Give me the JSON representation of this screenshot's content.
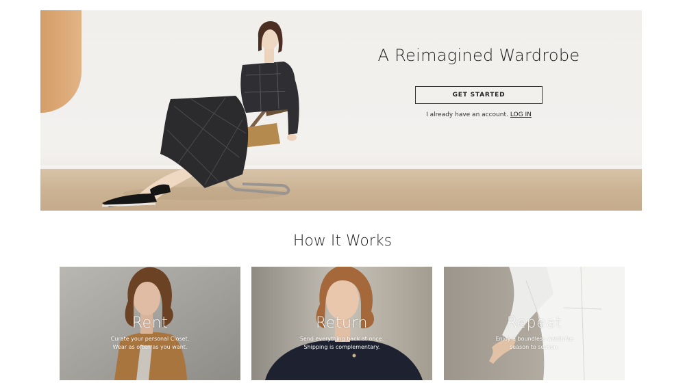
{
  "hero": {
    "title": "A Reimagined Wardrobe",
    "cta_label": "GET STARTED",
    "login_prompt": "I already have an account.",
    "login_link": "LOG IN"
  },
  "how_it_works": {
    "title": "How It Works",
    "cards": [
      {
        "title": "Rent",
        "desc_line1": "Curate your personal Closet.",
        "desc_line2": "Wear as often as you want."
      },
      {
        "title": "Return",
        "desc_line1": "Send everything back at once.",
        "desc_line2": "Shipping is complementary."
      },
      {
        "title": "Repeat",
        "desc_line1": "Enjoy a boundless wardrobe",
        "desc_line2": "season to season."
      }
    ]
  },
  "colors": {
    "text": "#222222",
    "background": "#ffffff",
    "hero_wall": "#f1efec",
    "hero_floor": "#cbb394"
  }
}
